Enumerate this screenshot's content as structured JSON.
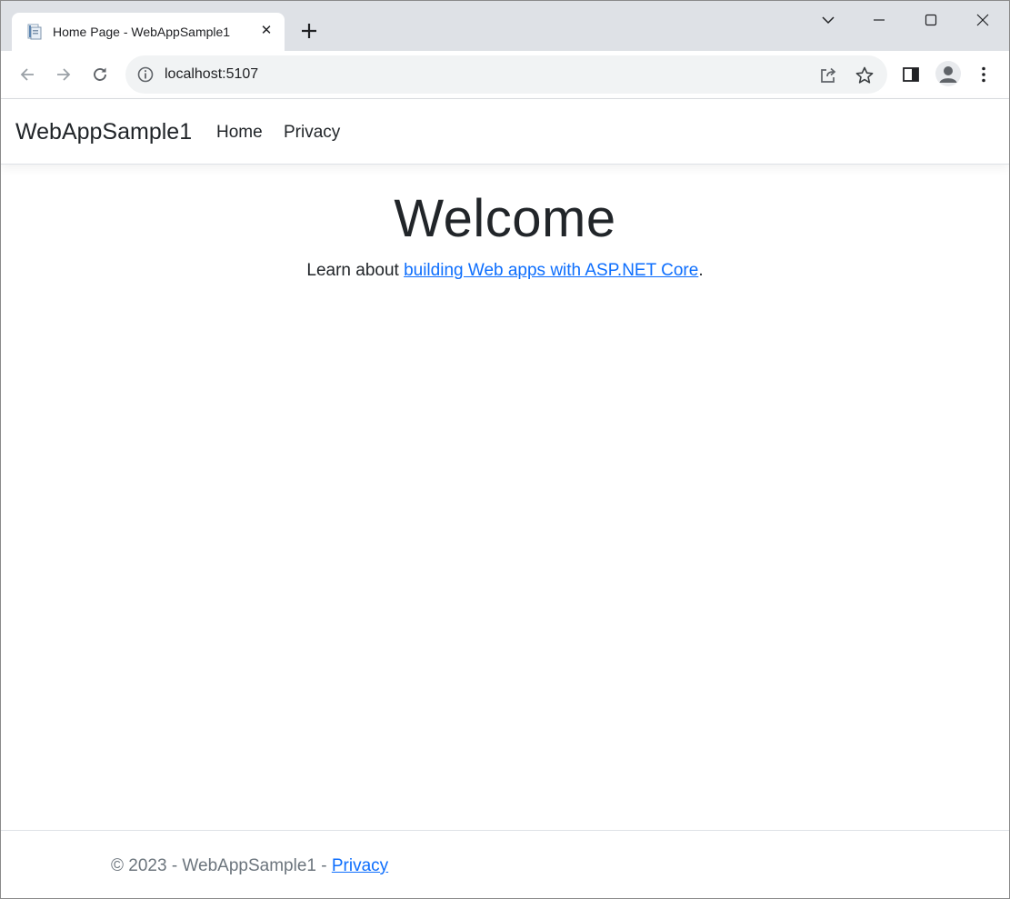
{
  "browser": {
    "tab_title": "Home Page - WebAppSample1",
    "url": "localhost:5107",
    "icons": {
      "favicon": "page-favicon-icon",
      "close": "close-icon",
      "new_tab": "plus-icon",
      "back": "arrow-left-icon",
      "forward": "arrow-right-icon",
      "reload": "reload-icon",
      "info": "info-icon",
      "share": "share-icon",
      "bookmark": "star-icon",
      "side_panel": "side-panel-icon",
      "profile": "profile-icon",
      "menu": "kebab-menu-icon"
    }
  },
  "navbar": {
    "brand": "WebAppSample1",
    "links": [
      "Home",
      "Privacy"
    ]
  },
  "main": {
    "heading": "Welcome",
    "lead_prefix": "Learn about ",
    "lead_link": "building Web apps with ASP.NET Core",
    "lead_suffix": "."
  },
  "footer": {
    "text": "© 2023 - WebAppSample1 - ",
    "privacy_link": "Privacy"
  },
  "colors": {
    "link": "#0d6efd",
    "text": "#212529",
    "muted": "#6c757d",
    "tabstrip": "#dee1e6",
    "omnibox": "#f1f3f4"
  }
}
